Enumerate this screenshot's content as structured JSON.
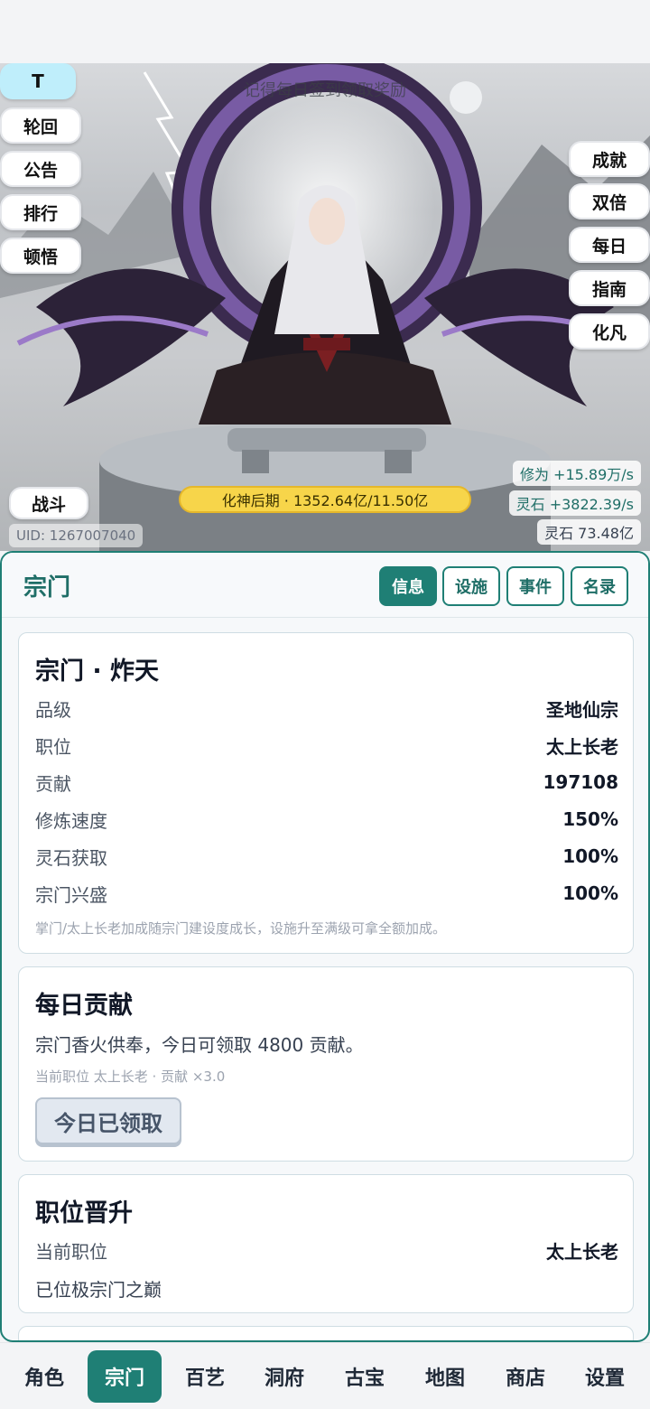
{
  "hero": {
    "notice": "记得每日签到领取奖励",
    "left_buttons": [
      "T",
      "轮回",
      "公告",
      "排行",
      "顿悟"
    ],
    "right_buttons": [
      "成就",
      "双倍",
      "每日",
      "指南",
      "化凡"
    ],
    "battle": "战斗",
    "realm": "化神后期 · 1352.64亿/11.50亿",
    "stats": [
      "修为 +15.89万/s",
      "灵石 +3822.39/s",
      "灵石 73.48亿"
    ],
    "uid": "UID: 1267007040"
  },
  "panel": {
    "title": "宗门",
    "tabs": [
      "信息",
      "设施",
      "事件",
      "名录"
    ],
    "sect_card": {
      "title": "宗门 · 炸天",
      "rows": [
        {
          "k": "品级",
          "v": "圣地仙宗"
        },
        {
          "k": "职位",
          "v": "太上长老"
        },
        {
          "k": "贡献",
          "v": "197108"
        },
        {
          "k": "修炼速度",
          "v": "150%"
        },
        {
          "k": "灵石获取",
          "v": "100%"
        },
        {
          "k": "宗门兴盛",
          "v": "100%"
        }
      ],
      "note": "掌门/太上长老加成随宗门建设度成长，设施升至满级可拿全额加成。"
    },
    "daily_card": {
      "title": "每日贡献",
      "text": "宗门香火供奉，今日可领取 4800 贡献。",
      "note": "当前职位 太上长老 · 贡献 ×3.0",
      "button": "今日已领取"
    },
    "promo_card": {
      "title": "职位晋升",
      "row": {
        "k": "当前职位",
        "v": "太上长老"
      },
      "text": "已位极宗门之巅"
    }
  },
  "nav": [
    "角色",
    "宗门",
    "百艺",
    "洞府",
    "古宝",
    "地图",
    "商店",
    "设置"
  ],
  "colors": {
    "accent": "#1f7f75",
    "realm": "#f7d54a"
  }
}
